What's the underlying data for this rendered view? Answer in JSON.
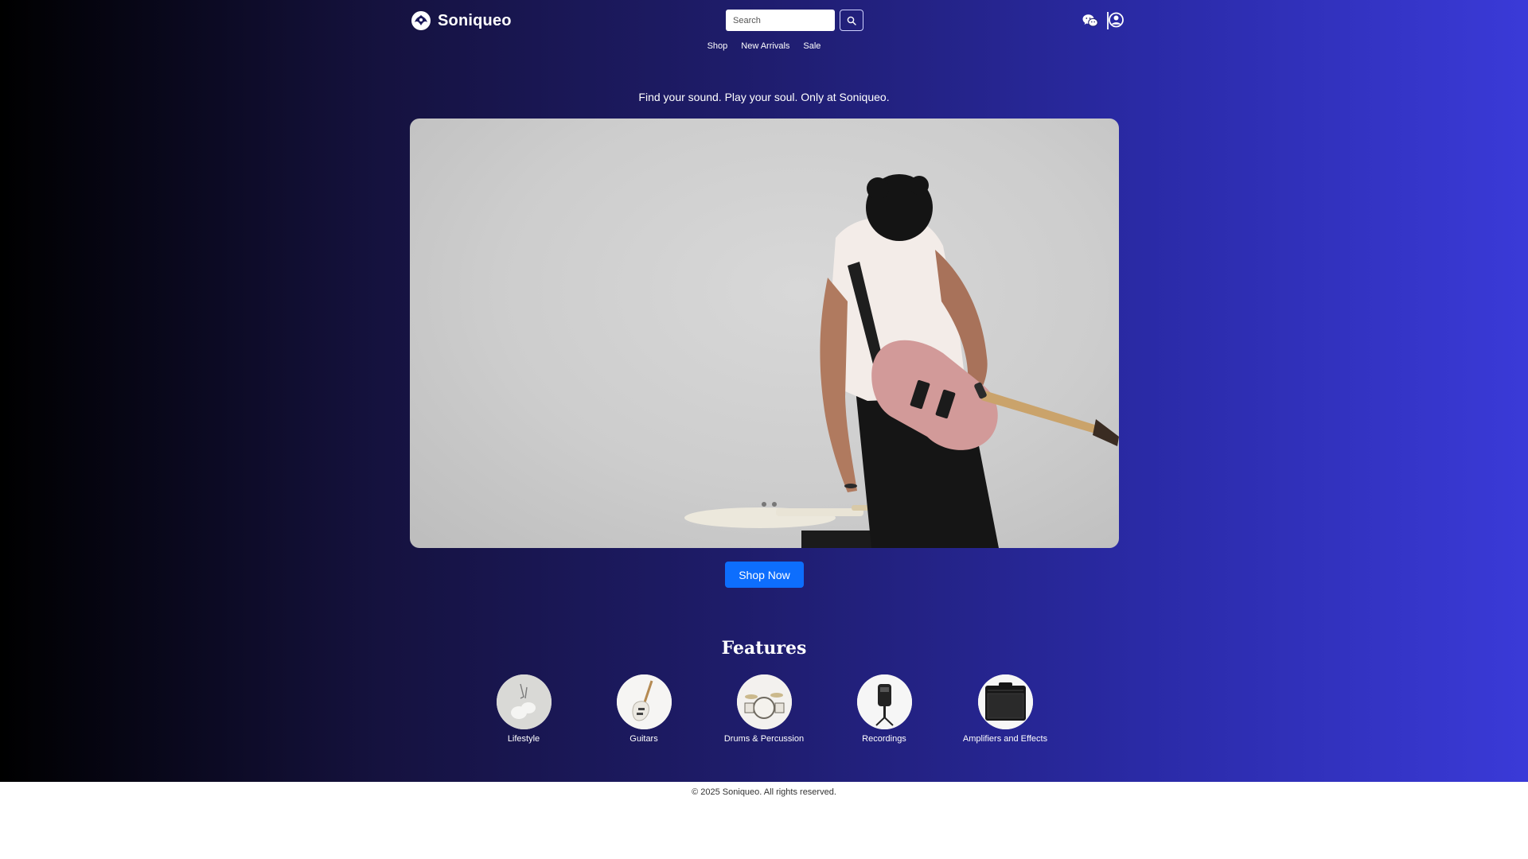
{
  "brand": {
    "name": "Soniqueo"
  },
  "header": {
    "search_placeholder": "Search",
    "nav": [
      {
        "label": "Shop"
      },
      {
        "label": "New Arrivals"
      },
      {
        "label": "Sale"
      }
    ],
    "icons": [
      "wechat-icon",
      "user-account-icon"
    ]
  },
  "hero": {
    "tagline": "Find your sound. Play your soul. Only at Soniqueo.",
    "cta_label": "Shop Now"
  },
  "features": {
    "title": "Features",
    "items": [
      {
        "label": "Lifestyle",
        "icon": "earbuds-icon"
      },
      {
        "label": "Guitars",
        "icon": "electric-guitar-icon"
      },
      {
        "label": "Drums & Percussion",
        "icon": "drum-kit-icon"
      },
      {
        "label": "Recordings",
        "icon": "microphone-icon"
      },
      {
        "label": "Amplifiers and Effects",
        "icon": "amplifier-icon"
      }
    ]
  },
  "footer": {
    "copyright": "© 2025 Soniqueo. All rights reserved."
  },
  "colors": {
    "accent": "#0d6efd",
    "gradient_start": "#000000",
    "gradient_end": "#3a3ad8"
  }
}
